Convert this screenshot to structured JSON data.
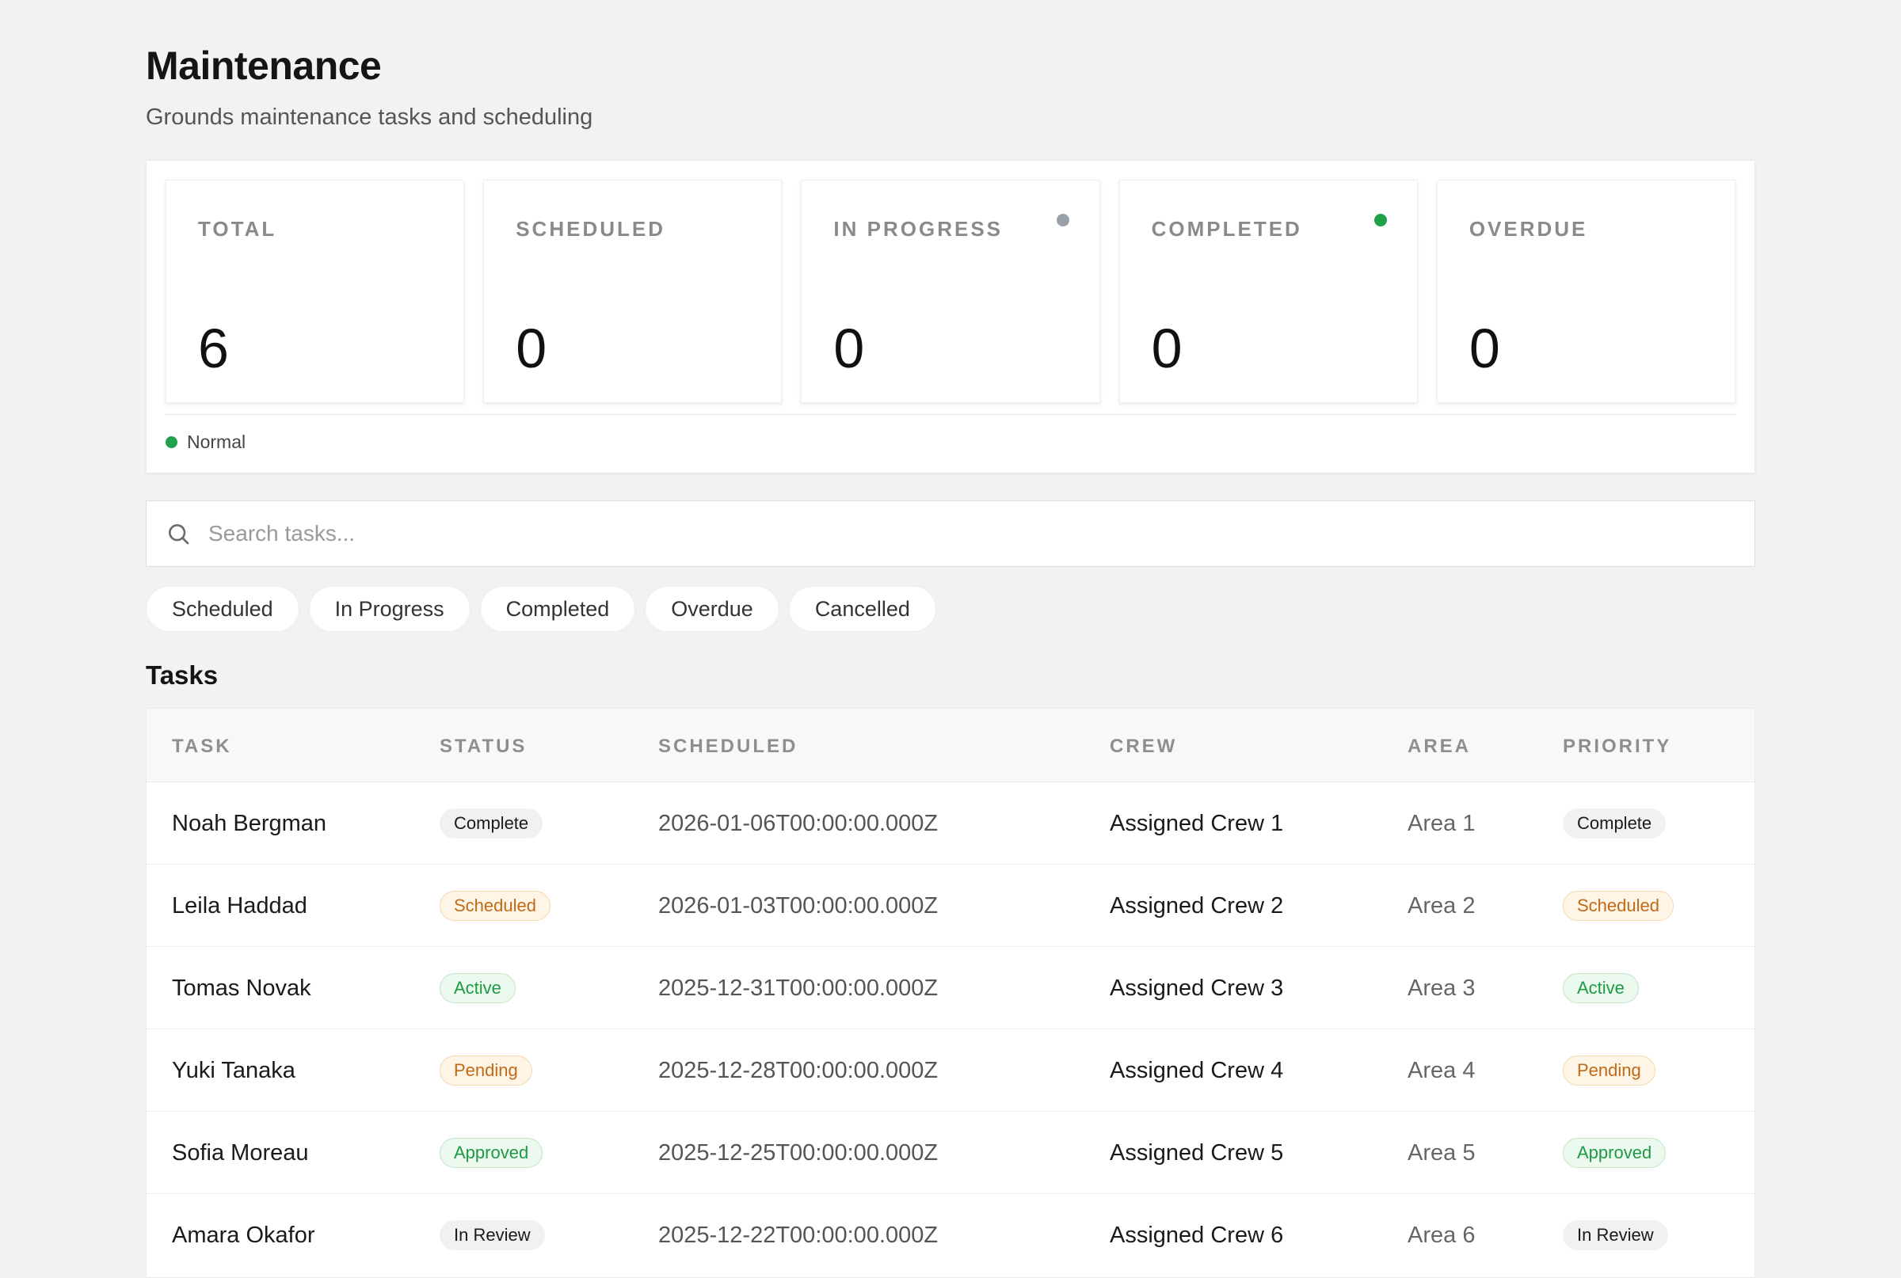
{
  "header": {
    "title": "Maintenance",
    "subtitle": "Grounds maintenance tasks and scheduling"
  },
  "stats": [
    {
      "label": "TOTAL",
      "value": "6",
      "dot": null
    },
    {
      "label": "SCHEDULED",
      "value": "0",
      "dot": null
    },
    {
      "label": "IN PROGRESS",
      "value": "0",
      "dot": "#9aa0a8"
    },
    {
      "label": "COMPLETED",
      "value": "0",
      "dot": "#1fa24a"
    },
    {
      "label": "OVERDUE",
      "value": "0",
      "dot": null
    }
  ],
  "status": {
    "label": "Normal",
    "color": "#1fa24a"
  },
  "search": {
    "placeholder": "Search tasks..."
  },
  "filters": [
    "Scheduled",
    "In Progress",
    "Completed",
    "Overdue",
    "Cancelled"
  ],
  "section": {
    "title": "Tasks"
  },
  "table": {
    "columns": [
      "TASK",
      "STATUS",
      "SCHEDULED",
      "CREW",
      "AREA",
      "PRIORITY"
    ],
    "rows": [
      {
        "task": "Noah Bergman",
        "status": "Complete",
        "scheduled": "2026-01-06T00:00:00.000Z",
        "crew": "Assigned Crew 1",
        "area": "Area 1",
        "priority": "Complete"
      },
      {
        "task": "Leila Haddad",
        "status": "Scheduled",
        "scheduled": "2026-01-03T00:00:00.000Z",
        "crew": "Assigned Crew 2",
        "area": "Area 2",
        "priority": "Scheduled"
      },
      {
        "task": "Tomas Novak",
        "status": "Active",
        "scheduled": "2025-12-31T00:00:00.000Z",
        "crew": "Assigned Crew 3",
        "area": "Area 3",
        "priority": "Active"
      },
      {
        "task": "Yuki Tanaka",
        "status": "Pending",
        "scheduled": "2025-12-28T00:00:00.000Z",
        "crew": "Assigned Crew 4",
        "area": "Area 4",
        "priority": "Pending"
      },
      {
        "task": "Sofia Moreau",
        "status": "Approved",
        "scheduled": "2025-12-25T00:00:00.000Z",
        "crew": "Assigned Crew 5",
        "area": "Area 5",
        "priority": "Approved"
      },
      {
        "task": "Amara Okafor",
        "status": "In Review",
        "scheduled": "2025-12-22T00:00:00.000Z",
        "crew": "Assigned Crew 6",
        "area": "Area 6",
        "priority": "In Review"
      }
    ]
  },
  "badge_colors": {
    "neutral": "#1a1a1a",
    "orange": "#c06a17",
    "green": "#1e9a45"
  }
}
